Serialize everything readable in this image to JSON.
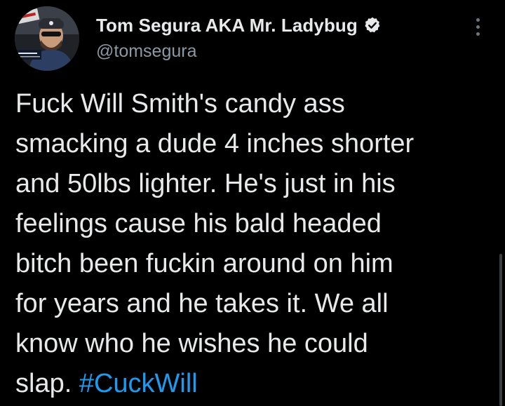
{
  "author": {
    "display_name": "Tom Segura AKA Mr. Ladybug",
    "handle": "@tomsegura",
    "verified": true
  },
  "tweet": {
    "lines": [
      "Fuck Will Smith's candy ass",
      "smacking a dude 4 inches shorter",
      "and 50lbs lighter. He's just in his",
      "feelings cause his bald headed",
      "bitch been fuckin around on him",
      "for years and he takes it. We all",
      "know who he wishes he could"
    ],
    "last_line_text": "slap. ",
    "hashtag": "#CuckWill"
  },
  "icons": {
    "verified": "verified-badge-icon",
    "more": "more-options-icon"
  },
  "colors": {
    "background": "#000000",
    "text": "#e7e9ea",
    "secondary_text": "#8b98a5",
    "link": "#1d9bf0"
  }
}
